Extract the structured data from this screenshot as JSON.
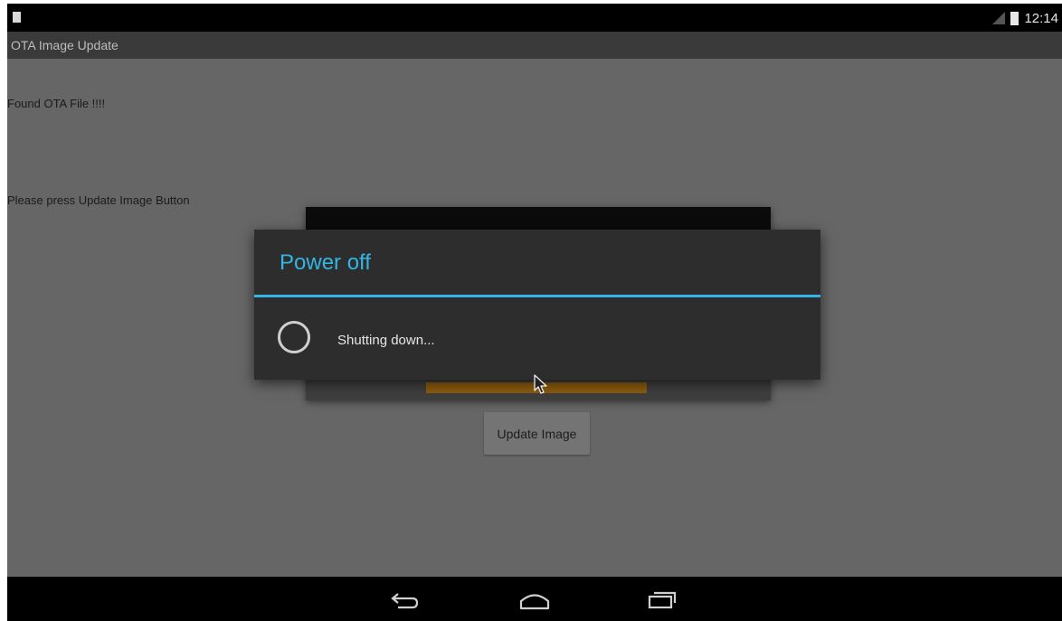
{
  "status_bar": {
    "time": "12:14"
  },
  "action_bar": {
    "title": "OTA Image Update"
  },
  "content": {
    "message1": "Found OTA File !!!!",
    "message2": "Please press Update Image Button",
    "update_button_label": "Update Image"
  },
  "dialog": {
    "title": "Power off",
    "message": "Shutting down..."
  },
  "icons": {
    "notification": "notification-icon",
    "signal": "signal-icon",
    "battery": "battery-icon",
    "spinner": "progress-spinner-icon",
    "cursor": "mouse-cursor-icon",
    "back": "back-icon",
    "home": "home-icon",
    "recents": "recent-apps-icon"
  },
  "colors": {
    "accent": "#33b5e5",
    "screen_background": "#666666",
    "dialog_background": "#2d2d2d"
  }
}
